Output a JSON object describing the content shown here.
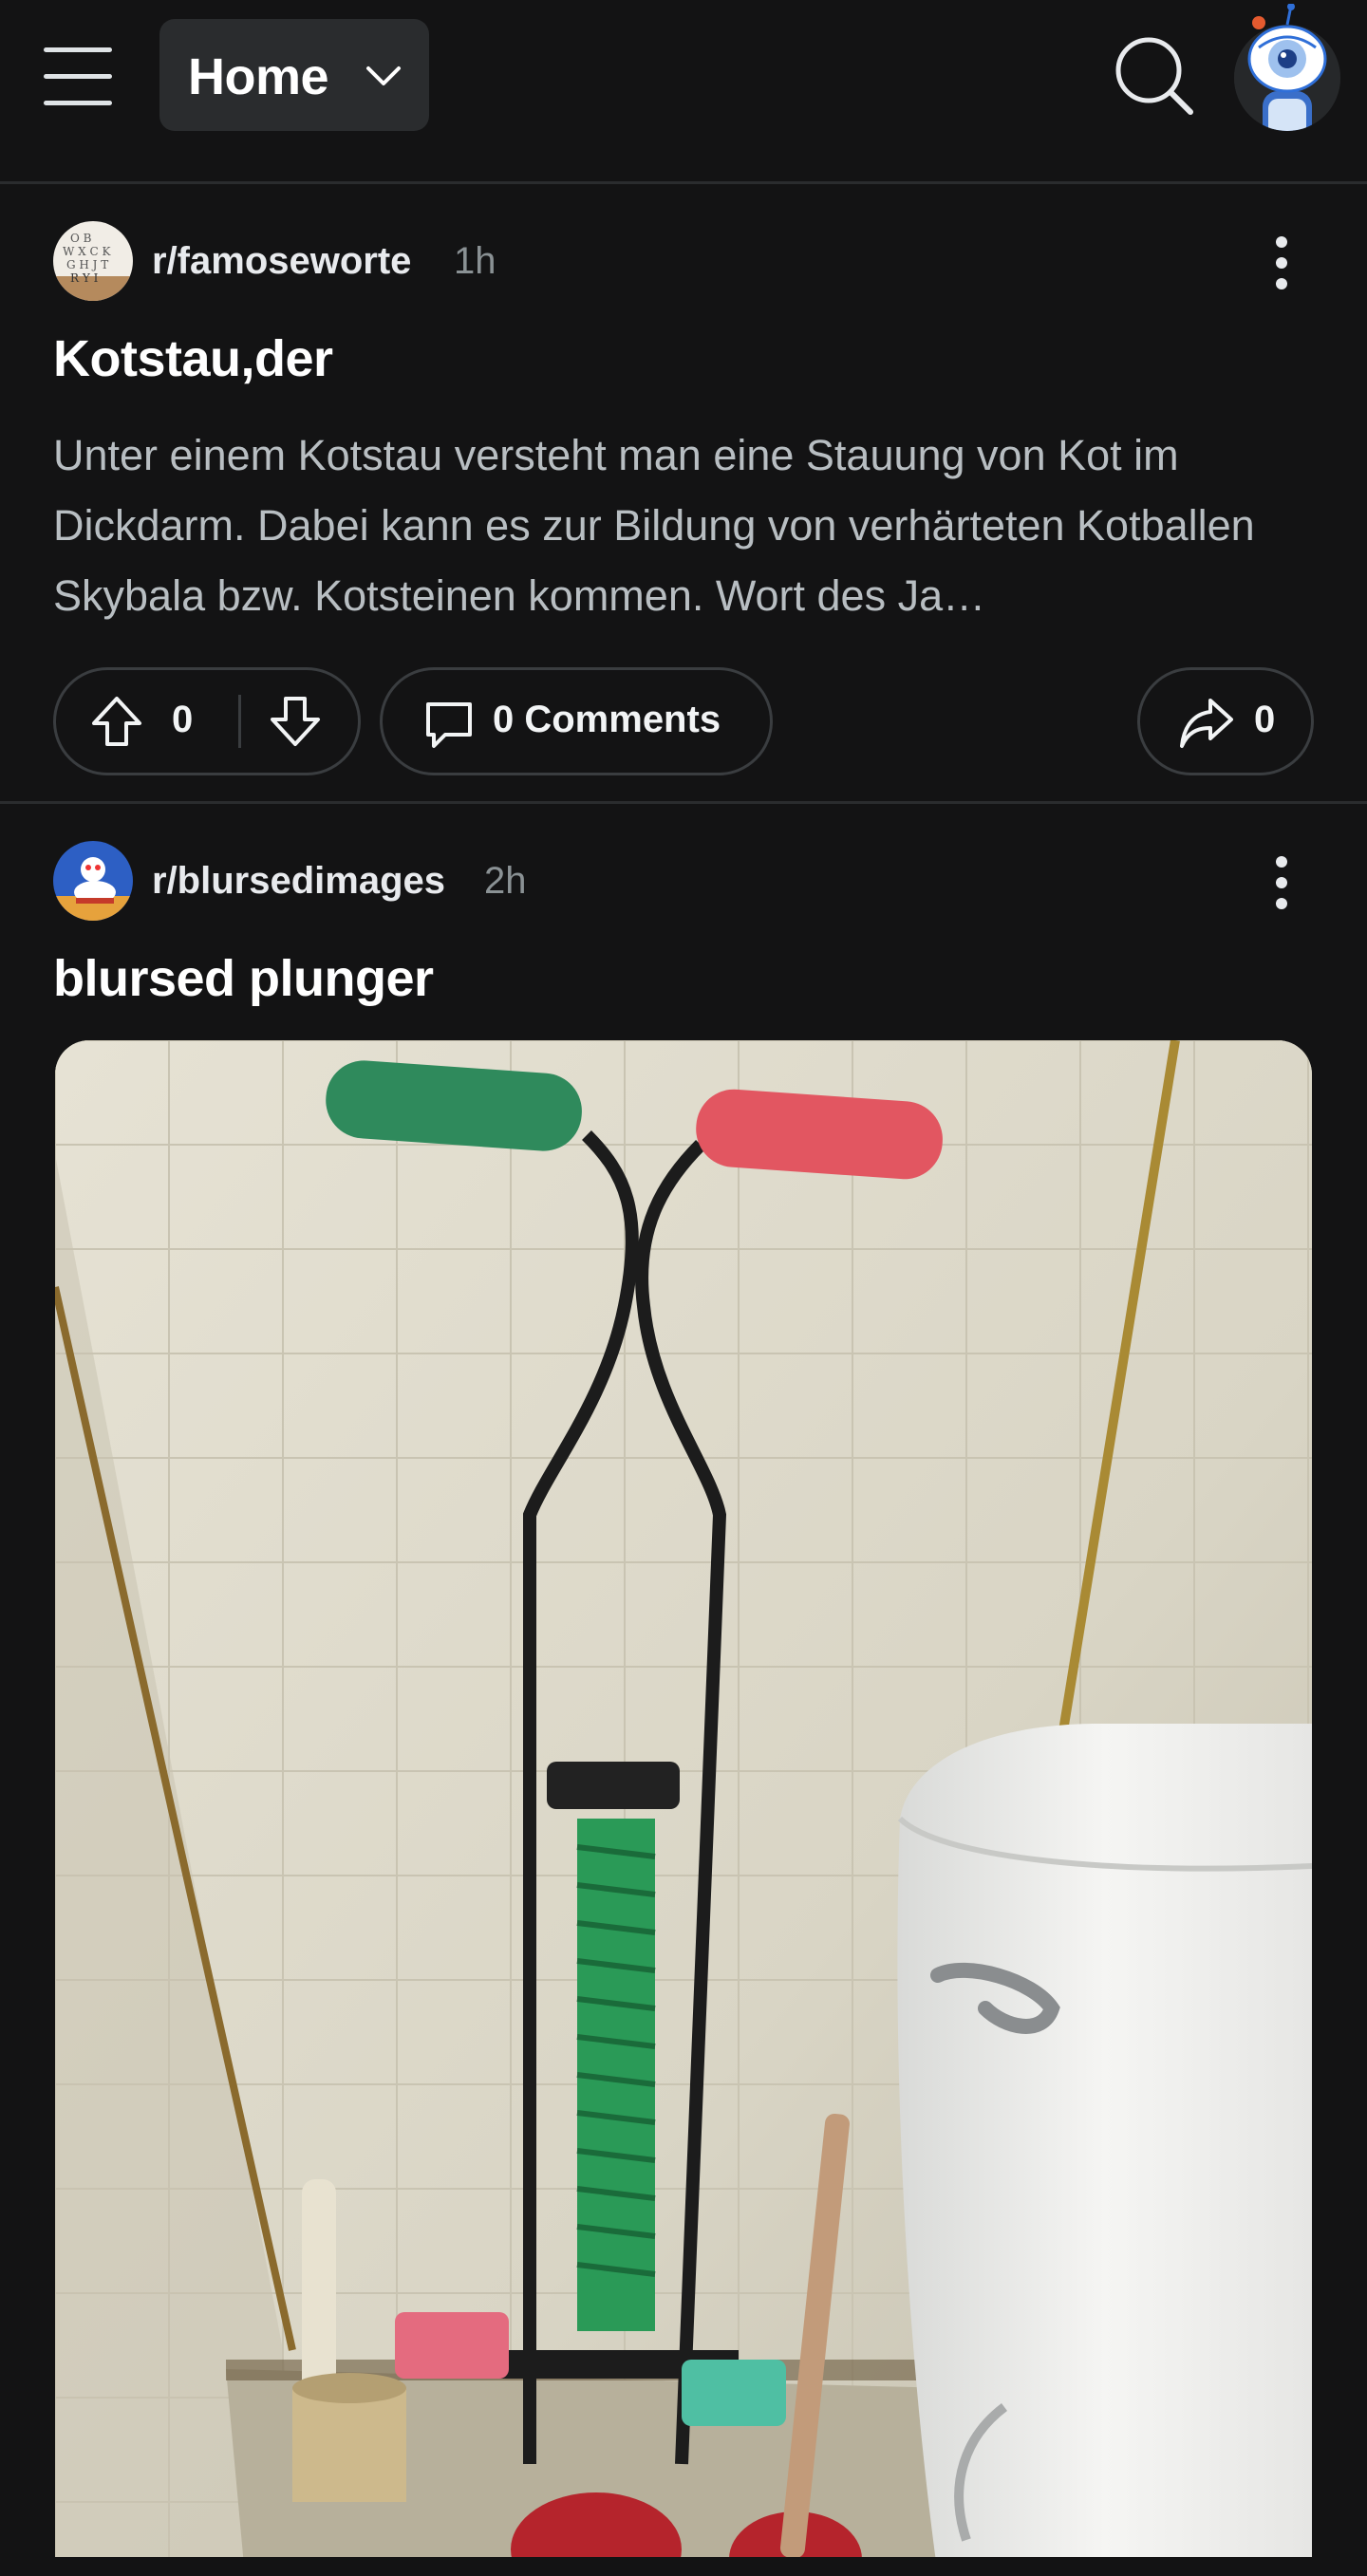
{
  "header": {
    "feed_label": "Home",
    "icons": {
      "menu": "hamburger-menu-icon",
      "dropdown": "chevron-down-icon",
      "search": "search-icon",
      "avatar": "user-avatar"
    }
  },
  "posts": [
    {
      "subreddit": "r/famoseworte",
      "time": "1h",
      "title": "Kotstau,der",
      "body": "Unter einem Kotstau versteht man eine Stauung von Kot im Dickdarm. Dabei kann es zur Bildung von verhärteten Kotballen Skybala bzw. Kotsteinen kommen. Wort des Ja…",
      "upvotes": "0",
      "comments_label": "0 Comments",
      "shares": "0"
    },
    {
      "subreddit": "r/blursedimages",
      "time": "2h",
      "title": "blursed plunger",
      "image_alt": "plunger pogo stick"
    }
  ],
  "colors": {
    "background": "#131314",
    "divider": "#2a2c2e",
    "pill_border": "#3a3d40",
    "text_primary": "#ffffff",
    "text_secondary": "#b8bec2",
    "text_muted": "#8a9194"
  }
}
